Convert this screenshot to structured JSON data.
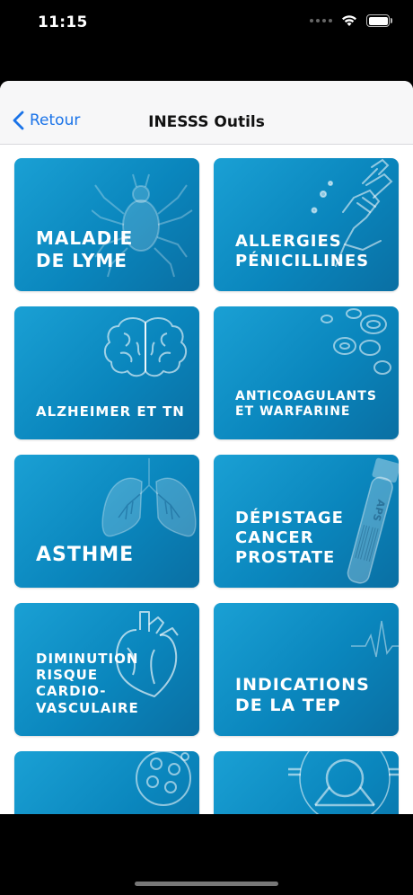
{
  "status_bar": {
    "time": "11:15"
  },
  "nav": {
    "back_label": "Retour",
    "title": "INESSS Outils"
  },
  "tiles": [
    {
      "label": "MALADIE\nDE LYME",
      "icon": "tick-icon"
    },
    {
      "label": "ALLERGIES\nPÉNICILLINES",
      "icon": "syringe-arm-icon"
    },
    {
      "label": "ALZHEIMER ET TN",
      "icon": "brain-icon"
    },
    {
      "label": "ANTICOAGULANTS\nET WARFARINE",
      "icon": "blood-cells-icon"
    },
    {
      "label": "ASTHME",
      "icon": "lungs-icon"
    },
    {
      "label": "DÉPISTAGE\nCANCER\nPROSTATE",
      "icon": "test-tube-icon",
      "tube_label": "APS"
    },
    {
      "label": "DIMINUTION\nRISQUE\nCARDIO-\nVASCULAIRE",
      "icon": "heart-icon"
    },
    {
      "label": "INDICATIONS\nDE LA TEP",
      "icon": "ecg-icon"
    },
    {
      "label": "",
      "icon": "cell-icon"
    },
    {
      "label": "",
      "icon": "scanner-icon"
    }
  ],
  "colors": {
    "tile_top": "#1aa0d4",
    "tile_bottom": "#0a6fa3",
    "link": "#1a73e8"
  }
}
